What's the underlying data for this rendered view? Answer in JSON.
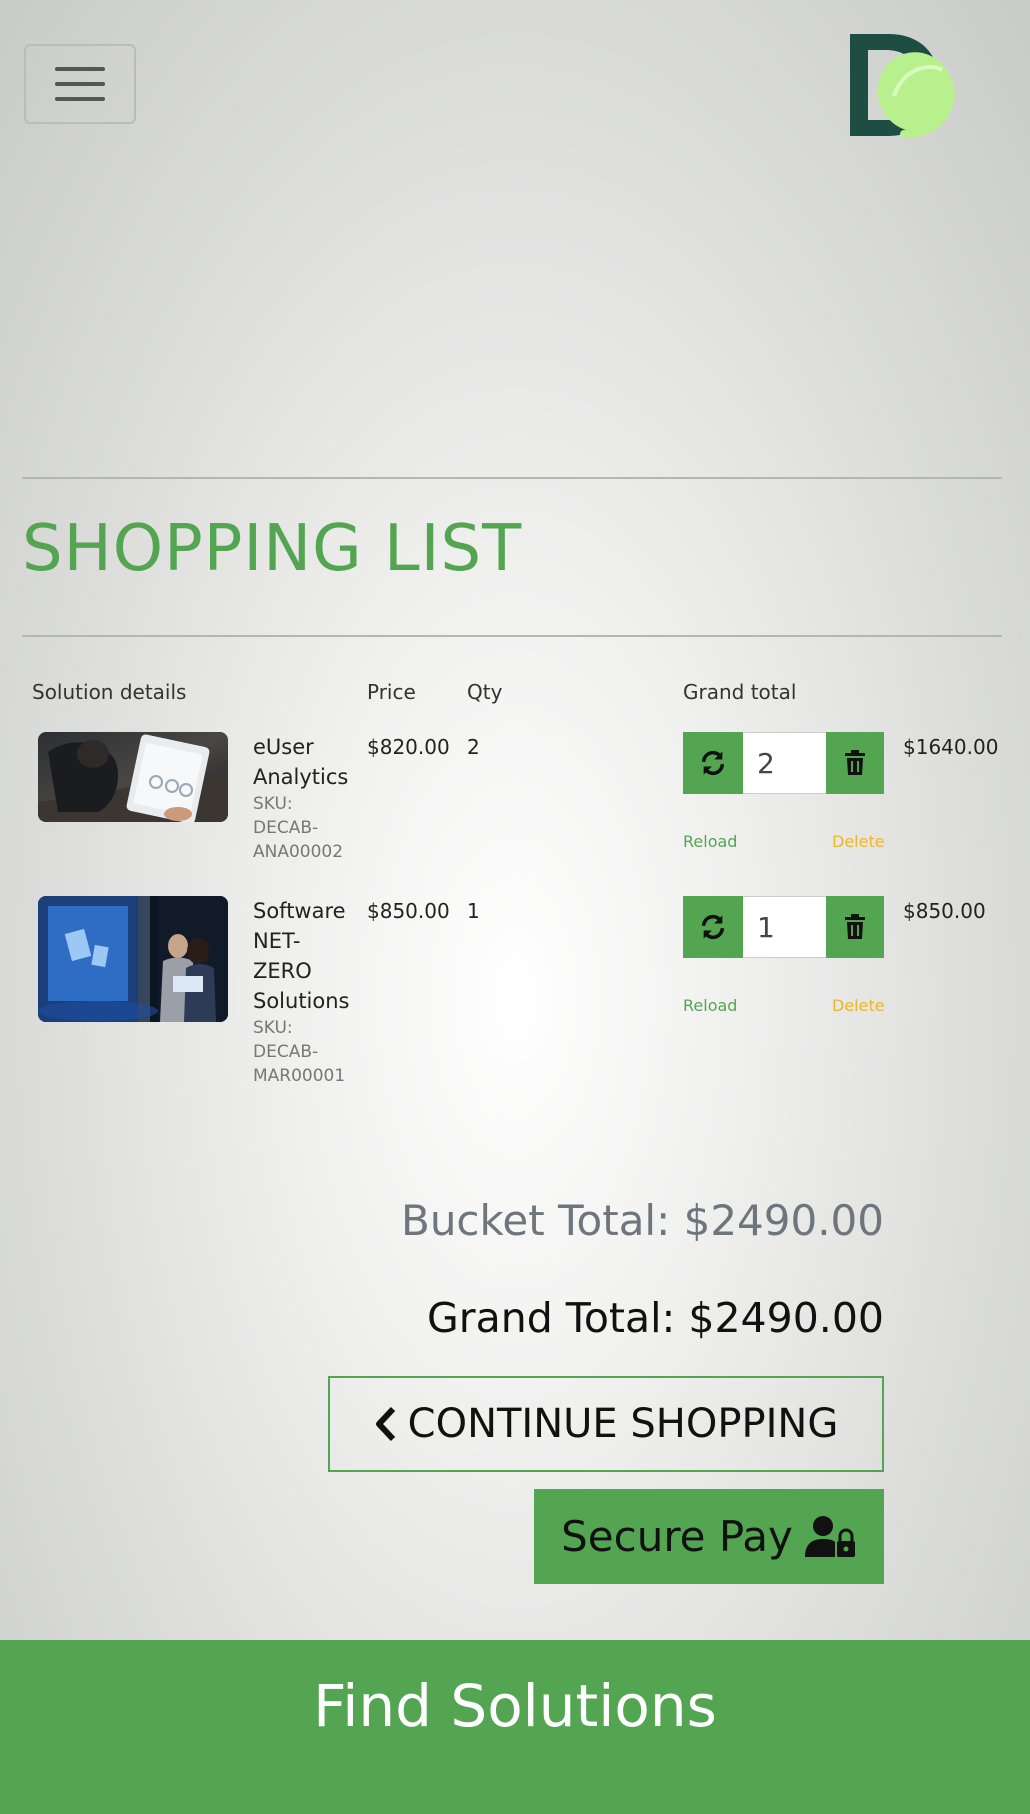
{
  "header": {
    "menu_icon": "hamburger-icon",
    "logo_icon": "leaf-d-logo"
  },
  "page": {
    "title": "SHOPPING LIST"
  },
  "table": {
    "headers": {
      "details": "Solution details",
      "price": "Price",
      "qty": "Qty",
      "grand_total": "Grand total"
    },
    "rows": [
      {
        "name_lines": [
          "eUser",
          "Analytics"
        ],
        "sku_lines": [
          "SKU:",
          "DECAB-",
          "ANA00002"
        ],
        "price": "$820.00",
        "qty": "2",
        "qty_input": "2",
        "reload": "Reload",
        "delete": "Delete",
        "total": "$1640.00"
      },
      {
        "name_lines": [
          "Software",
          "NET-",
          "ZERO",
          "Solutions"
        ],
        "sku_lines": [
          "SKU:",
          "DECAB-",
          "MAR00001"
        ],
        "price": "$850.00",
        "qty": "1",
        "qty_input": "1",
        "reload": "Reload",
        "delete": "Delete",
        "total": "$850.00"
      }
    ]
  },
  "totals": {
    "bucket": "Bucket Total: $2490.00",
    "grand": "Grand Total: $2490.00"
  },
  "buttons": {
    "continue": "CONTINUE SHOPPING",
    "pay": "Secure Pay"
  },
  "footer": {
    "label": "Find Solutions"
  },
  "colors": {
    "accent": "#53a551",
    "delete": "#f0b429"
  }
}
